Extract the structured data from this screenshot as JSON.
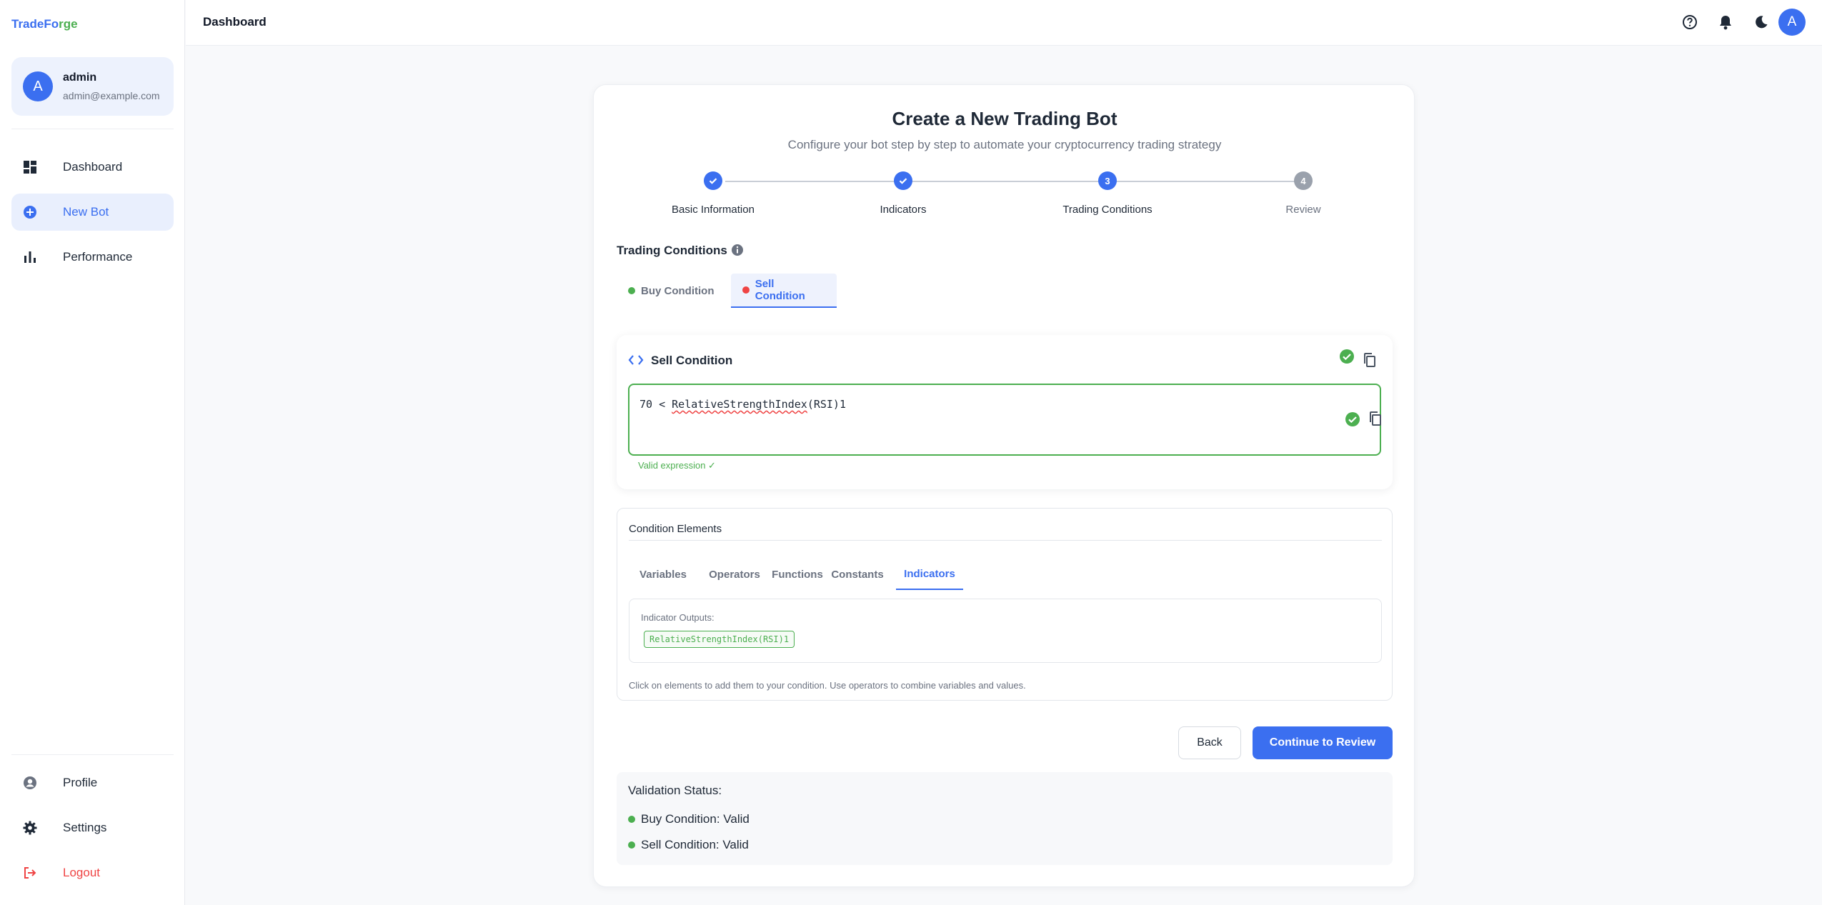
{
  "brand": {
    "part1": "TradeFo",
    "part2": "rge"
  },
  "user": {
    "initial": "A",
    "name": "admin",
    "email": "admin@example.com"
  },
  "nav": {
    "dashboard": "Dashboard",
    "new_bot": "New Bot",
    "performance": "Performance",
    "profile": "Profile",
    "settings": "Settings",
    "logout": "Logout"
  },
  "header": {
    "title": "Dashboard",
    "avatar_initial": "A"
  },
  "page": {
    "title": "Create a New Trading Bot",
    "subtitle": "Configure your bot step by step to automate your cryptocurrency trading strategy"
  },
  "steps": [
    {
      "number": "1",
      "label": "Basic Information",
      "state": "done"
    },
    {
      "number": "2",
      "label": "Indicators",
      "state": "done"
    },
    {
      "number": "3",
      "label": "Trading Conditions",
      "state": "current"
    },
    {
      "number": "4",
      "label": "Review",
      "state": "todo"
    }
  ],
  "trading_conditions": {
    "title": "Trading Conditions",
    "tabs": [
      {
        "label": "Buy Condition",
        "color": "#4caf50",
        "active": false
      },
      {
        "label": "Sell Condition",
        "color": "#ef4444",
        "active": true
      }
    ]
  },
  "sell_condition": {
    "title": "Sell Condition",
    "expression_prefix": "70 < ",
    "expression_token": "RelativeStrengthIndex",
    "expression_suffix": "(RSI)1",
    "valid_message": "Valid expression ✓"
  },
  "condition_elements": {
    "title": "Condition Elements",
    "tabs": [
      "Variables",
      "Operators",
      "Functions",
      "Constants",
      "Indicators"
    ],
    "active_tab": "Indicators",
    "outputs_label": "Indicator Outputs:",
    "outputs": [
      "RelativeStrengthIndex(RSI)1"
    ],
    "help_text": "Click on elements to add them to your condition. Use operators to combine variables and values."
  },
  "actions": {
    "back": "Back",
    "continue": "Continue to Review"
  },
  "validation": {
    "title": "Validation Status:",
    "items": [
      "Buy Condition: Valid",
      "Sell Condition: Valid"
    ]
  },
  "colors": {
    "primary": "#3b6ff0",
    "success": "#4caf50",
    "danger": "#ef4444"
  }
}
